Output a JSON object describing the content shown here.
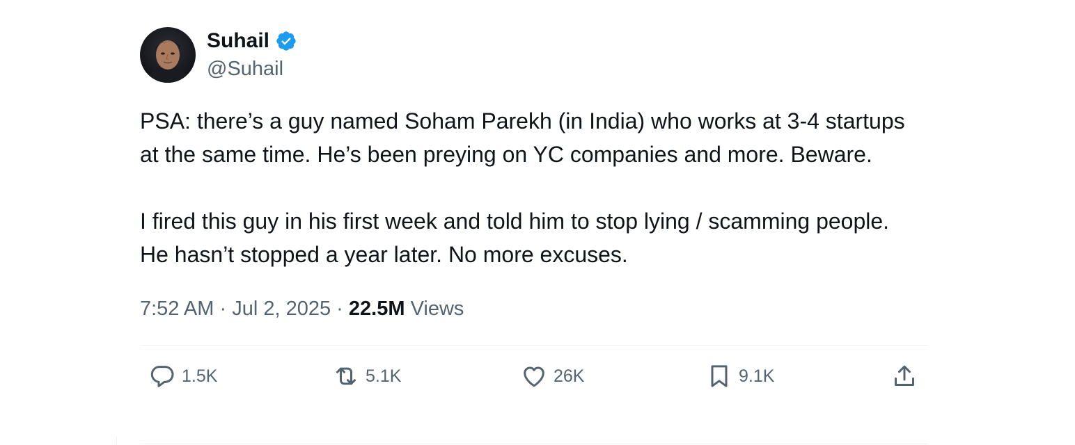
{
  "author": {
    "display_name": "Suhail",
    "handle": "@Suhail",
    "verified": true,
    "verified_color": "#1d9bf0"
  },
  "tweet": {
    "paragraphs": [
      "PSA: there’s a guy named Soham Parekh (in India) who works at 3-4 startups at the same time. He’s been preying on YC companies and more. Beware.",
      "I fired this guy in his first week and told him to stop lying / scamming people. He hasn’t stopped a year later. No more excuses."
    ],
    "time": "7:52 AM",
    "separator": "·",
    "date": "Jul 2, 2025",
    "views_count": "22.5M",
    "views_label": "Views"
  },
  "actions": {
    "replies": {
      "icon": "reply-icon",
      "count": "1.5K"
    },
    "reposts": {
      "icon": "repost-icon",
      "count": "5.1K"
    },
    "likes": {
      "icon": "heart-icon",
      "count": "26K"
    },
    "bookmarks": {
      "icon": "bookmark-icon",
      "count": "9.1K"
    },
    "share": {
      "icon": "share-icon"
    }
  },
  "colors": {
    "text_primary": "#0f1419",
    "text_secondary": "#536471",
    "divider": "#eff3f4"
  }
}
